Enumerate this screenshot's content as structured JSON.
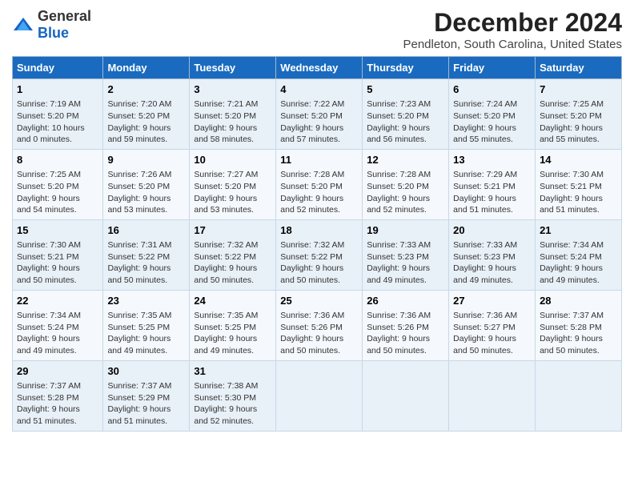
{
  "logo": {
    "general": "General",
    "blue": "Blue"
  },
  "title": "December 2024",
  "subtitle": "Pendleton, South Carolina, United States",
  "days_header": [
    "Sunday",
    "Monday",
    "Tuesday",
    "Wednesday",
    "Thursday",
    "Friday",
    "Saturday"
  ],
  "weeks": [
    [
      {
        "day": "1",
        "info": "Sunrise: 7:19 AM\nSunset: 5:20 PM\nDaylight: 10 hours\nand 0 minutes."
      },
      {
        "day": "2",
        "info": "Sunrise: 7:20 AM\nSunset: 5:20 PM\nDaylight: 9 hours\nand 59 minutes."
      },
      {
        "day": "3",
        "info": "Sunrise: 7:21 AM\nSunset: 5:20 PM\nDaylight: 9 hours\nand 58 minutes."
      },
      {
        "day": "4",
        "info": "Sunrise: 7:22 AM\nSunset: 5:20 PM\nDaylight: 9 hours\nand 57 minutes."
      },
      {
        "day": "5",
        "info": "Sunrise: 7:23 AM\nSunset: 5:20 PM\nDaylight: 9 hours\nand 56 minutes."
      },
      {
        "day": "6",
        "info": "Sunrise: 7:24 AM\nSunset: 5:20 PM\nDaylight: 9 hours\nand 55 minutes."
      },
      {
        "day": "7",
        "info": "Sunrise: 7:25 AM\nSunset: 5:20 PM\nDaylight: 9 hours\nand 55 minutes."
      }
    ],
    [
      {
        "day": "8",
        "info": "Sunrise: 7:25 AM\nSunset: 5:20 PM\nDaylight: 9 hours\nand 54 minutes."
      },
      {
        "day": "9",
        "info": "Sunrise: 7:26 AM\nSunset: 5:20 PM\nDaylight: 9 hours\nand 53 minutes."
      },
      {
        "day": "10",
        "info": "Sunrise: 7:27 AM\nSunset: 5:20 PM\nDaylight: 9 hours\nand 53 minutes."
      },
      {
        "day": "11",
        "info": "Sunrise: 7:28 AM\nSunset: 5:20 PM\nDaylight: 9 hours\nand 52 minutes."
      },
      {
        "day": "12",
        "info": "Sunrise: 7:28 AM\nSunset: 5:20 PM\nDaylight: 9 hours\nand 52 minutes."
      },
      {
        "day": "13",
        "info": "Sunrise: 7:29 AM\nSunset: 5:21 PM\nDaylight: 9 hours\nand 51 minutes."
      },
      {
        "day": "14",
        "info": "Sunrise: 7:30 AM\nSunset: 5:21 PM\nDaylight: 9 hours\nand 51 minutes."
      }
    ],
    [
      {
        "day": "15",
        "info": "Sunrise: 7:30 AM\nSunset: 5:21 PM\nDaylight: 9 hours\nand 50 minutes."
      },
      {
        "day": "16",
        "info": "Sunrise: 7:31 AM\nSunset: 5:22 PM\nDaylight: 9 hours\nand 50 minutes."
      },
      {
        "day": "17",
        "info": "Sunrise: 7:32 AM\nSunset: 5:22 PM\nDaylight: 9 hours\nand 50 minutes."
      },
      {
        "day": "18",
        "info": "Sunrise: 7:32 AM\nSunset: 5:22 PM\nDaylight: 9 hours\nand 50 minutes."
      },
      {
        "day": "19",
        "info": "Sunrise: 7:33 AM\nSunset: 5:23 PM\nDaylight: 9 hours\nand 49 minutes."
      },
      {
        "day": "20",
        "info": "Sunrise: 7:33 AM\nSunset: 5:23 PM\nDaylight: 9 hours\nand 49 minutes."
      },
      {
        "day": "21",
        "info": "Sunrise: 7:34 AM\nSunset: 5:24 PM\nDaylight: 9 hours\nand 49 minutes."
      }
    ],
    [
      {
        "day": "22",
        "info": "Sunrise: 7:34 AM\nSunset: 5:24 PM\nDaylight: 9 hours\nand 49 minutes."
      },
      {
        "day": "23",
        "info": "Sunrise: 7:35 AM\nSunset: 5:25 PM\nDaylight: 9 hours\nand 49 minutes."
      },
      {
        "day": "24",
        "info": "Sunrise: 7:35 AM\nSunset: 5:25 PM\nDaylight: 9 hours\nand 49 minutes."
      },
      {
        "day": "25",
        "info": "Sunrise: 7:36 AM\nSunset: 5:26 PM\nDaylight: 9 hours\nand 50 minutes."
      },
      {
        "day": "26",
        "info": "Sunrise: 7:36 AM\nSunset: 5:26 PM\nDaylight: 9 hours\nand 50 minutes."
      },
      {
        "day": "27",
        "info": "Sunrise: 7:36 AM\nSunset: 5:27 PM\nDaylight: 9 hours\nand 50 minutes."
      },
      {
        "day": "28",
        "info": "Sunrise: 7:37 AM\nSunset: 5:28 PM\nDaylight: 9 hours\nand 50 minutes."
      }
    ],
    [
      {
        "day": "29",
        "info": "Sunrise: 7:37 AM\nSunset: 5:28 PM\nDaylight: 9 hours\nand 51 minutes."
      },
      {
        "day": "30",
        "info": "Sunrise: 7:37 AM\nSunset: 5:29 PM\nDaylight: 9 hours\nand 51 minutes."
      },
      {
        "day": "31",
        "info": "Sunrise: 7:38 AM\nSunset: 5:30 PM\nDaylight: 9 hours\nand 52 minutes."
      },
      {
        "day": "",
        "info": ""
      },
      {
        "day": "",
        "info": ""
      },
      {
        "day": "",
        "info": ""
      },
      {
        "day": "",
        "info": ""
      }
    ]
  ]
}
